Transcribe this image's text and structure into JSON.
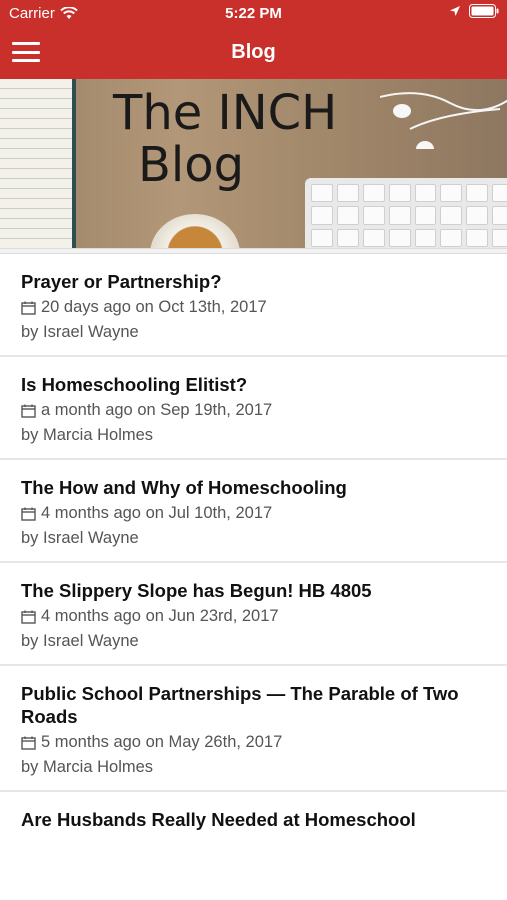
{
  "status_bar": {
    "carrier": "Carrier",
    "time": "5:22 PM"
  },
  "nav": {
    "title": "Blog",
    "menu_icon": "hamburger-menu-icon"
  },
  "hero": {
    "title_line1": "The INCH",
    "title_line2": "Blog"
  },
  "posts": [
    {
      "title": "Prayer or Partnership?",
      "meta": "20 days ago on Oct 13th, 2017",
      "author": "by Israel Wayne"
    },
    {
      "title": "Is Homeschooling Elitist?",
      "meta": "a month ago on Sep 19th, 2017",
      "author": "by Marcia Holmes"
    },
    {
      "title": "The How and Why of Homeschooling",
      "meta": "4 months ago on Jul 10th, 2017",
      "author": "by Israel Wayne"
    },
    {
      "title": "The Slippery Slope has Begun! HB 4805",
      "meta": "4 months ago on Jun 23rd, 2017",
      "author": "by Israel Wayne"
    },
    {
      "title": "Public School Partnerships — The Parable of Two Roads",
      "meta": "5 months ago on May 26th, 2017",
      "author": "by Marcia Holmes"
    },
    {
      "title": "Are Husbands Really Needed at Homeschool",
      "meta": "",
      "author": ""
    }
  ],
  "colors": {
    "accent": "#c9302c",
    "text": "#111111",
    "meta": "#555555"
  }
}
